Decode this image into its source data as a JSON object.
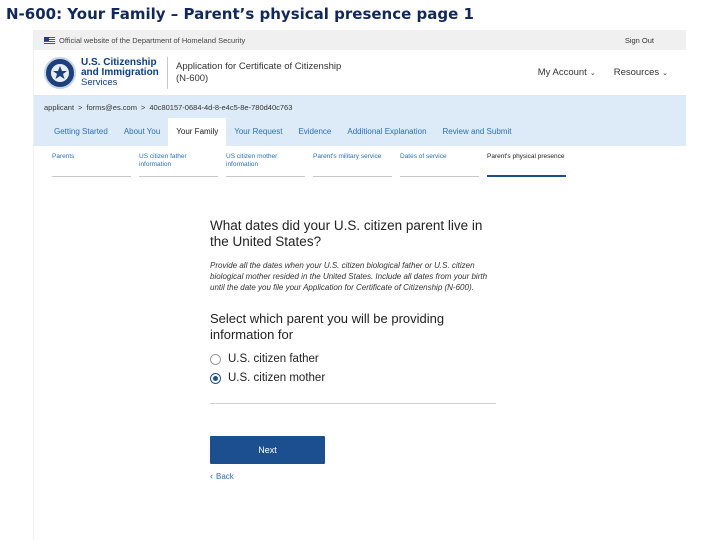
{
  "slide": {
    "title": "N-600: Your Family – Parent’s physical presence  page 1"
  },
  "banner": {
    "official_text": "Official website of the Department of Homeland Security",
    "sign_out": "Sign Out"
  },
  "header": {
    "agency_line1": "U.S. Citizenship",
    "agency_line2": "and Immigration",
    "agency_line3": "Services",
    "app_title_line1": "Application for Certificate of Citizenship",
    "app_title_line2": "(N-600)",
    "my_account": "My Account",
    "resources": "Resources"
  },
  "breadcrumb": {
    "items": [
      "applicant",
      "forms@es.com",
      "40c80157-0684-4d-8-e4c5-8e-780d40c763"
    ]
  },
  "tabs": [
    {
      "label": "Getting Started",
      "active": false
    },
    {
      "label": "About You",
      "active": false
    },
    {
      "label": "Your Family",
      "active": true
    },
    {
      "label": "Your Request",
      "active": false
    },
    {
      "label": "Evidence",
      "active": false
    },
    {
      "label": "Additional Explanation",
      "active": false
    },
    {
      "label": "Review and Submit",
      "active": false
    }
  ],
  "subtabs": [
    {
      "label": "Parents",
      "active": false
    },
    {
      "label": "US citizen father information",
      "active": false
    },
    {
      "label": "US citizen mother information",
      "active": false
    },
    {
      "label": "Parent's military service",
      "active": false
    },
    {
      "label": "Dates of service",
      "active": false
    },
    {
      "label": "Parent's physical presence",
      "active": true
    }
  ],
  "question": {
    "title": "What dates did your U.S. citizen parent live in the United States?",
    "help": "Provide all the dates when your U.S. citizen biological father or U.S. citizen biological mother resided in the United States. Include all dates from your birth until the date you file your Application for Certificate of Citizenship (N-600).",
    "select_label": "Select which parent you will be providing information for",
    "options": [
      {
        "label": "U.S. citizen father",
        "checked": false
      },
      {
        "label": "U.S. citizen mother",
        "checked": true
      }
    ]
  },
  "actions": {
    "next": "Next",
    "back": "Back"
  }
}
